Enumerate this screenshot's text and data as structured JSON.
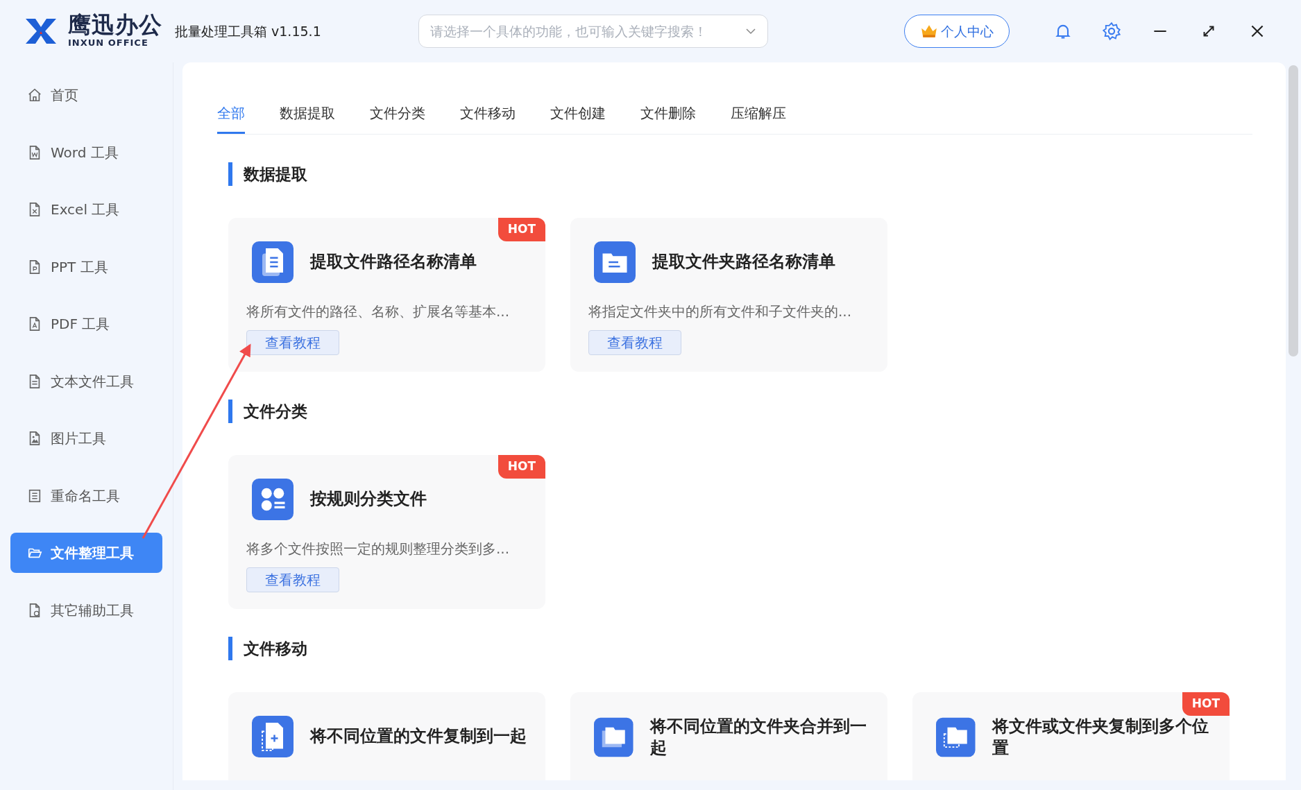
{
  "app": {
    "brand": "鹰迅办公",
    "brand_en": "INXUN OFFICE",
    "title": "批量处理工具箱",
    "version": "v1.15.1"
  },
  "search": {
    "placeholder": "请选择一个具体的功能，也可输入关键字搜索！"
  },
  "user_button": "个人中心",
  "sidebar": {
    "items": [
      {
        "label": "首页",
        "kind": "home",
        "selected": false
      },
      {
        "label": "Word 工具",
        "kind": "word",
        "selected": false
      },
      {
        "label": "Excel 工具",
        "kind": "excel",
        "selected": false
      },
      {
        "label": "PPT 工具",
        "kind": "ppt",
        "selected": false
      },
      {
        "label": "PDF 工具",
        "kind": "pdf",
        "selected": false
      },
      {
        "label": "文本文件工具",
        "kind": "text",
        "selected": false
      },
      {
        "label": "图片工具",
        "kind": "image",
        "selected": false
      },
      {
        "label": "重命名工具",
        "kind": "list",
        "selected": false
      },
      {
        "label": "文件整理工具",
        "kind": "folder",
        "selected": true
      },
      {
        "label": "其它辅助工具",
        "kind": "other",
        "selected": false
      }
    ]
  },
  "tabs": [
    {
      "label": "全部",
      "selected": true
    },
    {
      "label": "数据提取",
      "selected": false
    },
    {
      "label": "文件分类",
      "selected": false
    },
    {
      "label": "文件移动",
      "selected": false
    },
    {
      "label": "文件创建",
      "selected": false
    },
    {
      "label": "文件删除",
      "selected": false
    },
    {
      "label": "压缩解压",
      "selected": false
    }
  ],
  "sections": [
    {
      "title": "数据提取",
      "cards": [
        {
          "kind": "file-list",
          "title": "提取文件路径名称清单",
          "description": "将所有文件的路径、名称、扩展名等基本...",
          "button": "查看教程",
          "hot": true,
          "hot_label": "HOT"
        },
        {
          "kind": "folder-list",
          "title": "提取文件夹路径名称清单",
          "description": "将指定文件夹中的所有文件和子文件夹的...",
          "button": "查看教程",
          "hot": false
        }
      ]
    },
    {
      "title": "文件分类",
      "cards": [
        {
          "kind": "grid",
          "title": "按规则分类文件",
          "description": "将多个文件按照一定的规则整理分类到多...",
          "button": "查看教程",
          "hot": true,
          "hot_label": "HOT"
        }
      ]
    },
    {
      "title": "文件移动",
      "cards": [
        {
          "kind": "file-add",
          "title": "将不同位置的文件复制到一起",
          "hot": false
        },
        {
          "kind": "folders",
          "title": "将不同位置的文件夹合并到一起",
          "hot": false
        },
        {
          "kind": "folder-copy",
          "title": "将文件或文件夹复制到多个位置",
          "hot": true,
          "hot_label": "HOT"
        }
      ]
    }
  ]
}
